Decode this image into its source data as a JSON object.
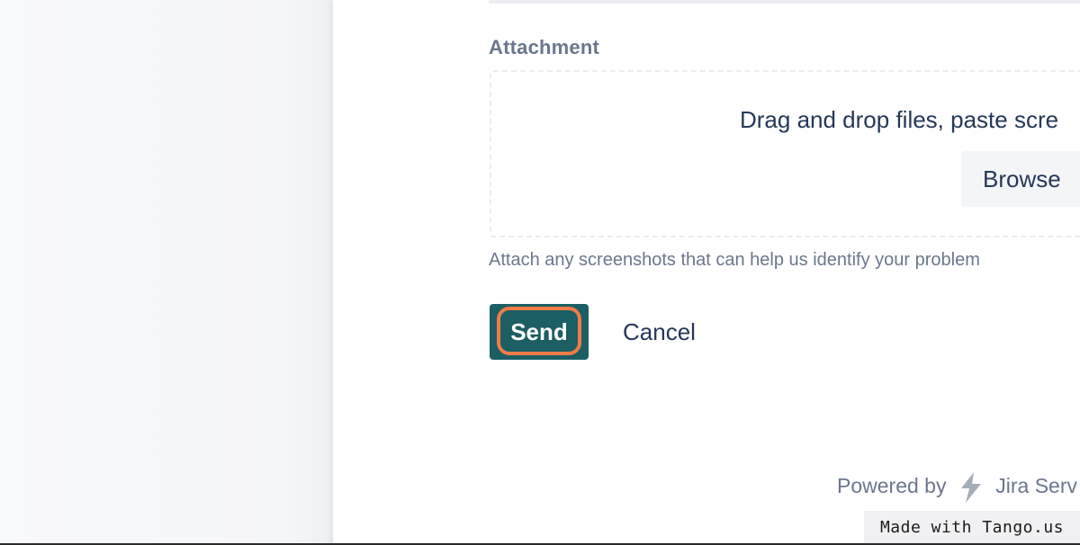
{
  "attachment": {
    "label": "Attachment",
    "drop_text": "Drag and drop files, paste scre",
    "browse_label": "Browse",
    "help_text": "Attach any screenshots that can help us identify your problem"
  },
  "actions": {
    "send_label": "Send",
    "cancel_label": "Cancel"
  },
  "footer": {
    "powered_prefix": "Powered by",
    "product_name": "Jira Serv"
  },
  "watermark": {
    "text": "Made with Tango.us"
  },
  "colors": {
    "send_button": "#1b5e63",
    "highlight_ring": "#f07b47",
    "primary_text": "#253858",
    "secondary_text": "#6b778c"
  },
  "icons": {
    "jira_logo": "lightning-bolt-icon"
  }
}
